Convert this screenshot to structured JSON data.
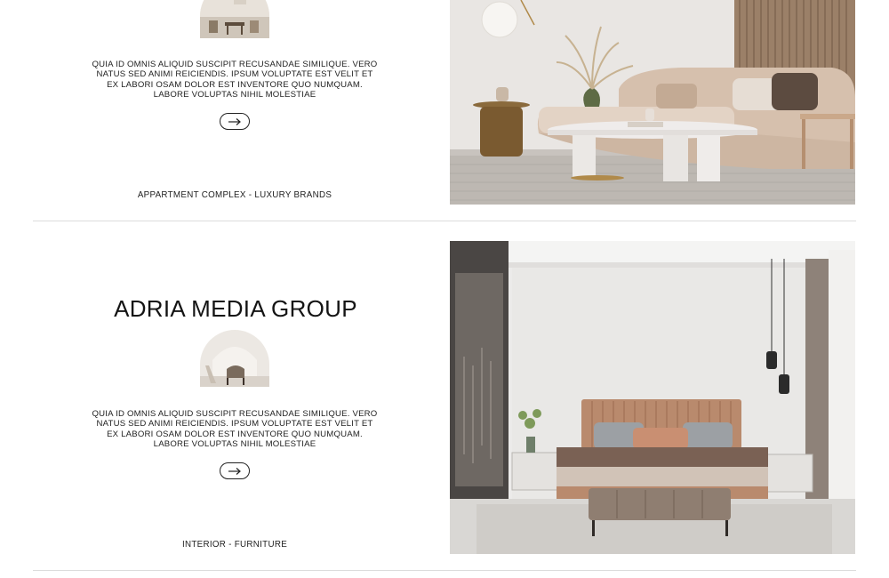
{
  "projects": [
    {
      "title": "",
      "description": "QUIA ID OMNIS ALIQUID SUSCIPIT RECUSANDAE SIMILIQUE. VERO NATUS SED ANIMI REICIENDIS. IPSUM VOLUPTATE EST VELIT ET EX LABORI OSAM DOLOR EST INVENTORE QUO NUMQUAM. LABORE VOLUPTAS NIHIL MOLESTIAE",
      "tags": "APPARTMENT COMPLEX - LUXURY BRANDS",
      "arrow_icon": "arrow-right-icon"
    },
    {
      "title": "ADRIA MEDIA GROUP",
      "description": "QUIA ID OMNIS ALIQUID SUSCIPIT RECUSANDAE SIMILIQUE. VERO NATUS SED ANIMI REICIENDIS. IPSUM VOLUPTATE EST VELIT ET EX LABORI OSAM DOLOR EST INVENTORE QUO NUMQUAM. LABORE VOLUPTAS NIHIL MOLESTIAE",
      "tags": "INTERIOR - FURNITURE",
      "arrow_icon": "arrow-right-icon"
    }
  ],
  "colors": {
    "text": "#1a1a1a",
    "divider": "#dcdcdc",
    "sofa": "#d9c4b2",
    "bed_leather": "#b98a6d"
  }
}
